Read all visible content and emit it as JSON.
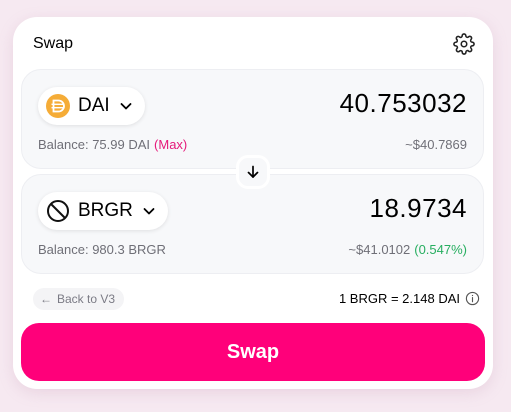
{
  "header": {
    "title": "Swap"
  },
  "input": {
    "token_symbol": "DAI",
    "token_icon": "dai-coin-icon",
    "amount": "40.753032",
    "balance_text": "Balance: 75.99 DAI",
    "max_label": "(Max)",
    "usd_value": "~$40.7869"
  },
  "output": {
    "token_symbol": "BRGR",
    "token_icon": "unknown-token-icon",
    "amount": "18.9734",
    "balance_text": "Balance: 980.3 BRGR",
    "usd_value": "~$41.0102",
    "usd_diff": "(0.547%)"
  },
  "footer": {
    "back_link": "Back to V3",
    "rate": "1 BRGR = 2.148 DAI"
  },
  "swap_button": {
    "label": "Swap"
  },
  "colors": {
    "accent": "#ff007a",
    "max_link": "#e5197a",
    "positive": "#27ae60",
    "dai_icon": "#f5ac37"
  }
}
